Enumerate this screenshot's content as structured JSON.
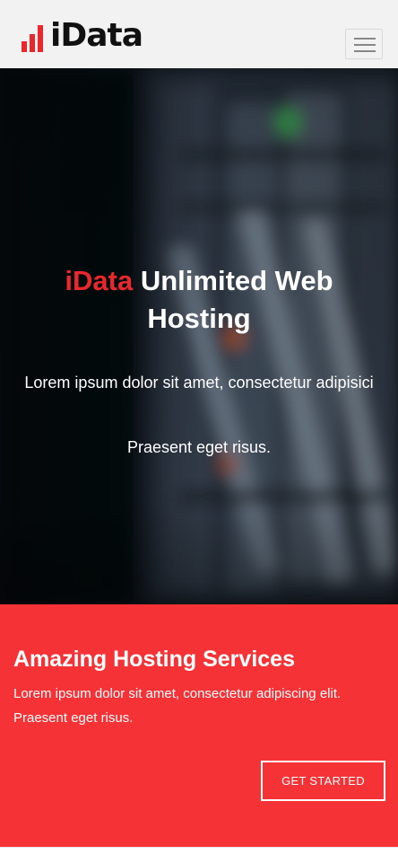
{
  "header": {
    "logo_text": "iData",
    "menu_icon": "hamburger-icon"
  },
  "hero": {
    "title_brand": "iData",
    "title_rest": " Unlimited Web Hosting",
    "text_line1": "Lorem ipsum dolor sit amet, consectetur adipisici",
    "text_line2": "Praesent eget risus."
  },
  "services": {
    "title": "Amazing Hosting Services",
    "text": "Lorem ipsum dolor sit amet, consectetur adipiscing elit. Praesent eget risus.",
    "button_label": "GET STARTED"
  },
  "colors": {
    "brand_red": "#e9282d",
    "section_red": "#f53236",
    "header_bg": "#f2f2f2"
  }
}
